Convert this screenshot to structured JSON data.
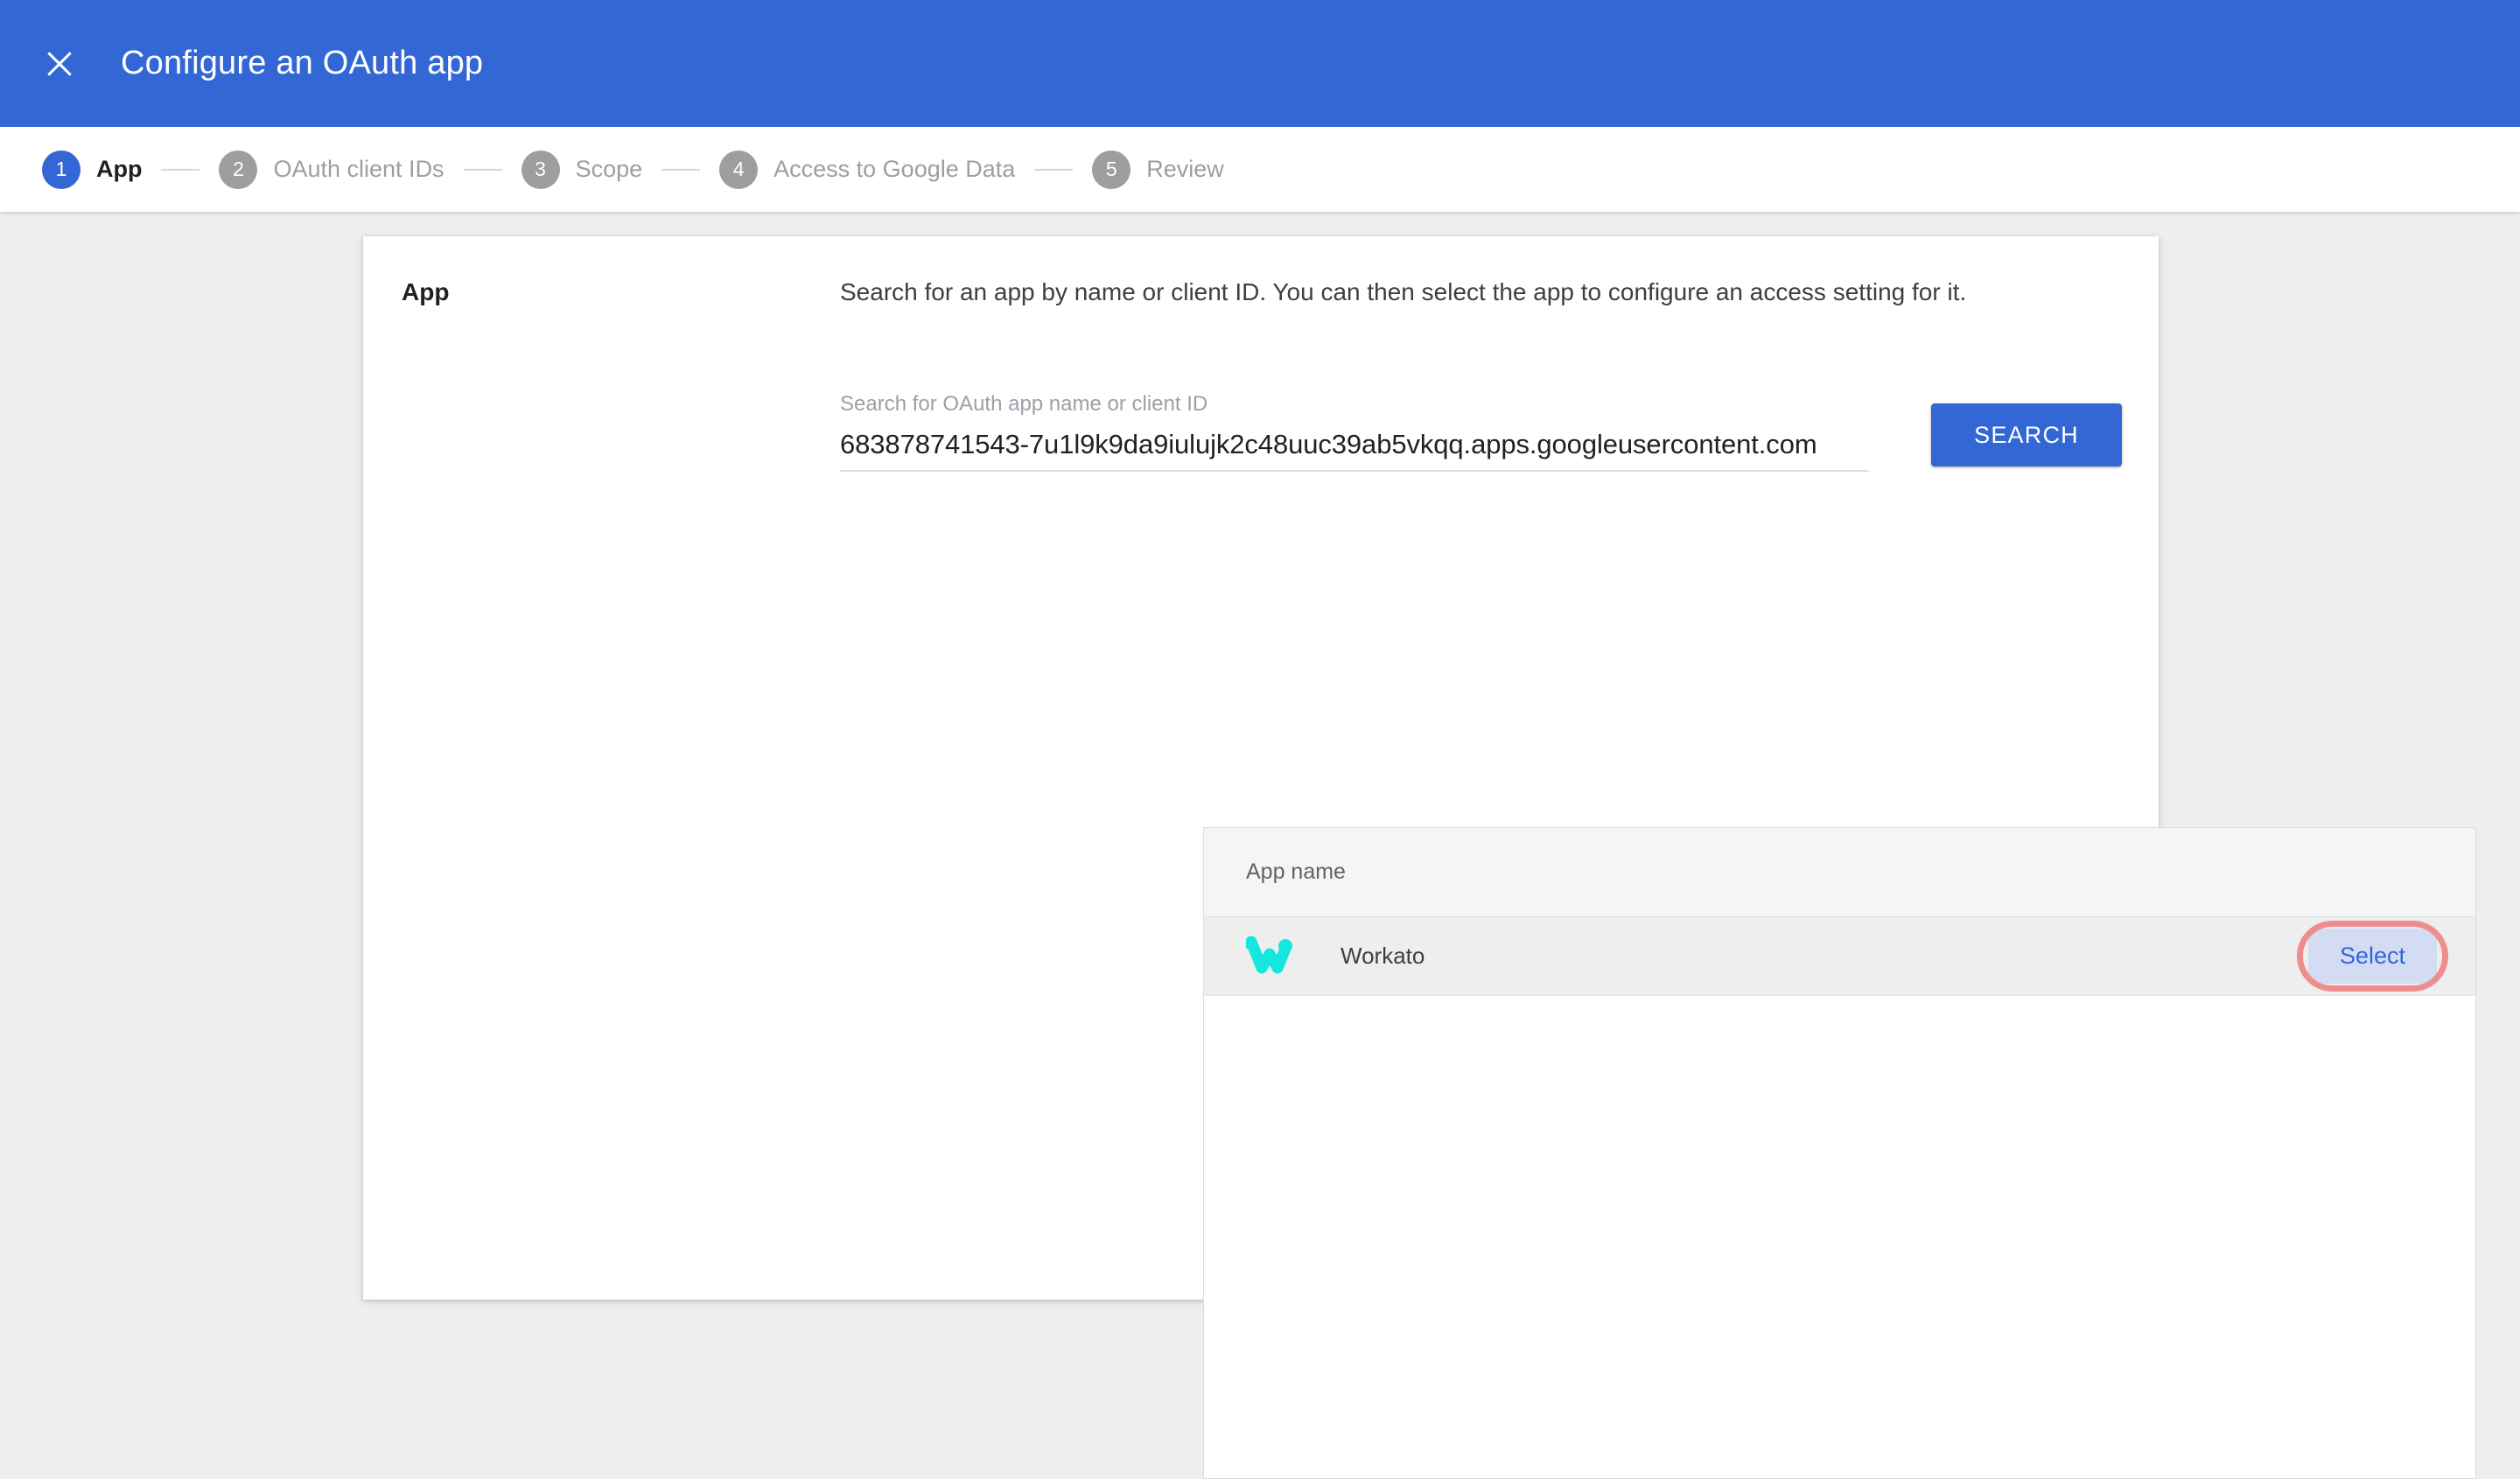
{
  "appbar": {
    "close_icon": "close-icon",
    "title": "Configure an OAuth app",
    "background_color": "#3367D6"
  },
  "stepper": {
    "active_index": 0,
    "active_color": "#3367D6",
    "inactive_color": "#9E9E9E",
    "steps": [
      {
        "number": "1",
        "label": "App"
      },
      {
        "number": "2",
        "label": "OAuth client IDs"
      },
      {
        "number": "3",
        "label": "Scope"
      },
      {
        "number": "4",
        "label": "Access to Google Data"
      },
      {
        "number": "5",
        "label": "Review"
      }
    ]
  },
  "card": {
    "section_title": "App",
    "description": "Search for an app by name or client ID. You can then select the app to configure an access setting for it."
  },
  "search": {
    "label": "Search for OAuth app name or client ID",
    "placeholder": "Search for OAuth app name or client ID",
    "value": "683878741543-7u1l9k9da9iulujk2c48uuc39ab5vkqq.apps.googleusercontent.com",
    "button_label": "SEARCH",
    "button_color": "#3367D6"
  },
  "results": {
    "columns": [
      "App name"
    ],
    "rows": [
      {
        "logo_icon": "workato-logo-icon",
        "logo_color": "#16E6E0",
        "app_name": "Workato",
        "action_label": "Select",
        "action_color": "#3367D6",
        "highlighted": true,
        "highlight_color": "#EE8D8D"
      }
    ]
  }
}
